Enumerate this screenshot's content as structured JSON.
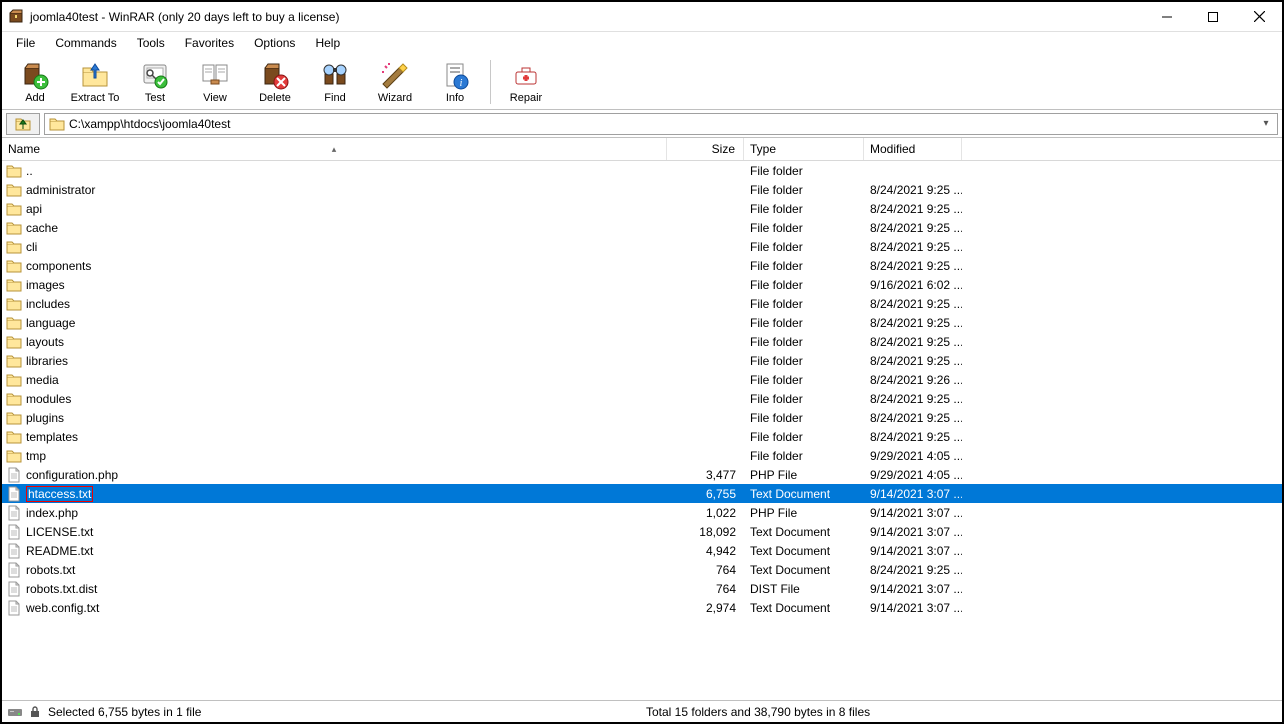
{
  "title": "joomla40test - WinRAR (only 20 days left to buy a license)",
  "menus": [
    "File",
    "Commands",
    "Tools",
    "Favorites",
    "Options",
    "Help"
  ],
  "toolbar": [
    {
      "label": "Add",
      "icon": "add"
    },
    {
      "label": "Extract To",
      "icon": "extract"
    },
    {
      "label": "Test",
      "icon": "test"
    },
    {
      "label": "View",
      "icon": "view"
    },
    {
      "label": "Delete",
      "icon": "delete"
    },
    {
      "label": "Find",
      "icon": "find"
    },
    {
      "label": "Wizard",
      "icon": "wizard"
    },
    {
      "label": "Info",
      "icon": "info"
    },
    {
      "sep": true
    },
    {
      "label": "Repair",
      "icon": "repair"
    }
  ],
  "path": "C:\\xampp\\htdocs\\joomla40test",
  "columns": {
    "name": "Name",
    "size": "Size",
    "type": "Type",
    "modified": "Modified"
  },
  "rows": [
    {
      "name": "..",
      "icon": "folder",
      "size": "",
      "type": "File folder",
      "mod": ""
    },
    {
      "name": "administrator",
      "icon": "folder",
      "size": "",
      "type": "File folder",
      "mod": "8/24/2021 9:25 ..."
    },
    {
      "name": "api",
      "icon": "folder",
      "size": "",
      "type": "File folder",
      "mod": "8/24/2021 9:25 ..."
    },
    {
      "name": "cache",
      "icon": "folder",
      "size": "",
      "type": "File folder",
      "mod": "8/24/2021 9:25 ..."
    },
    {
      "name": "cli",
      "icon": "folder",
      "size": "",
      "type": "File folder",
      "mod": "8/24/2021 9:25 ..."
    },
    {
      "name": "components",
      "icon": "folder",
      "size": "",
      "type": "File folder",
      "mod": "8/24/2021 9:25 ..."
    },
    {
      "name": "images",
      "icon": "folder",
      "size": "",
      "type": "File folder",
      "mod": "9/16/2021 6:02 ..."
    },
    {
      "name": "includes",
      "icon": "folder",
      "size": "",
      "type": "File folder",
      "mod": "8/24/2021 9:25 ..."
    },
    {
      "name": "language",
      "icon": "folder",
      "size": "",
      "type": "File folder",
      "mod": "8/24/2021 9:25 ..."
    },
    {
      "name": "layouts",
      "icon": "folder",
      "size": "",
      "type": "File folder",
      "mod": "8/24/2021 9:25 ..."
    },
    {
      "name": "libraries",
      "icon": "folder",
      "size": "",
      "type": "File folder",
      "mod": "8/24/2021 9:25 ..."
    },
    {
      "name": "media",
      "icon": "folder",
      "size": "",
      "type": "File folder",
      "mod": "8/24/2021 9:26 ..."
    },
    {
      "name": "modules",
      "icon": "folder",
      "size": "",
      "type": "File folder",
      "mod": "8/24/2021 9:25 ..."
    },
    {
      "name": "plugins",
      "icon": "folder",
      "size": "",
      "type": "File folder",
      "mod": "8/24/2021 9:25 ..."
    },
    {
      "name": "templates",
      "icon": "folder",
      "size": "",
      "type": "File folder",
      "mod": "8/24/2021 9:25 ..."
    },
    {
      "name": "tmp",
      "icon": "folder",
      "size": "",
      "type": "File folder",
      "mod": "9/29/2021 4:05 ..."
    },
    {
      "name": "configuration.php",
      "icon": "file",
      "size": "3,477",
      "type": "PHP File",
      "mod": "9/29/2021 4:05 ..."
    },
    {
      "name": "htaccess.txt",
      "icon": "file",
      "size": "6,755",
      "type": "Text Document",
      "mod": "9/14/2021 3:07 ...",
      "selected": true,
      "highlight": true
    },
    {
      "name": "index.php",
      "icon": "file",
      "size": "1,022",
      "type": "PHP File",
      "mod": "9/14/2021 3:07 ..."
    },
    {
      "name": "LICENSE.txt",
      "icon": "file",
      "size": "18,092",
      "type": "Text Document",
      "mod": "9/14/2021 3:07 ..."
    },
    {
      "name": "README.txt",
      "icon": "file",
      "size": "4,942",
      "type": "Text Document",
      "mod": "9/14/2021 3:07 ..."
    },
    {
      "name": "robots.txt",
      "icon": "file",
      "size": "764",
      "type": "Text Document",
      "mod": "8/24/2021 9:25 ..."
    },
    {
      "name": "robots.txt.dist",
      "icon": "file",
      "size": "764",
      "type": "DIST File",
      "mod": "9/14/2021 3:07 ..."
    },
    {
      "name": "web.config.txt",
      "icon": "file",
      "size": "2,974",
      "type": "Text Document",
      "mod": "9/14/2021 3:07 ..."
    }
  ],
  "status_left": "Selected 6,755 bytes in 1 file",
  "status_right": "Total 15 folders and 38,790 bytes in 8 files"
}
